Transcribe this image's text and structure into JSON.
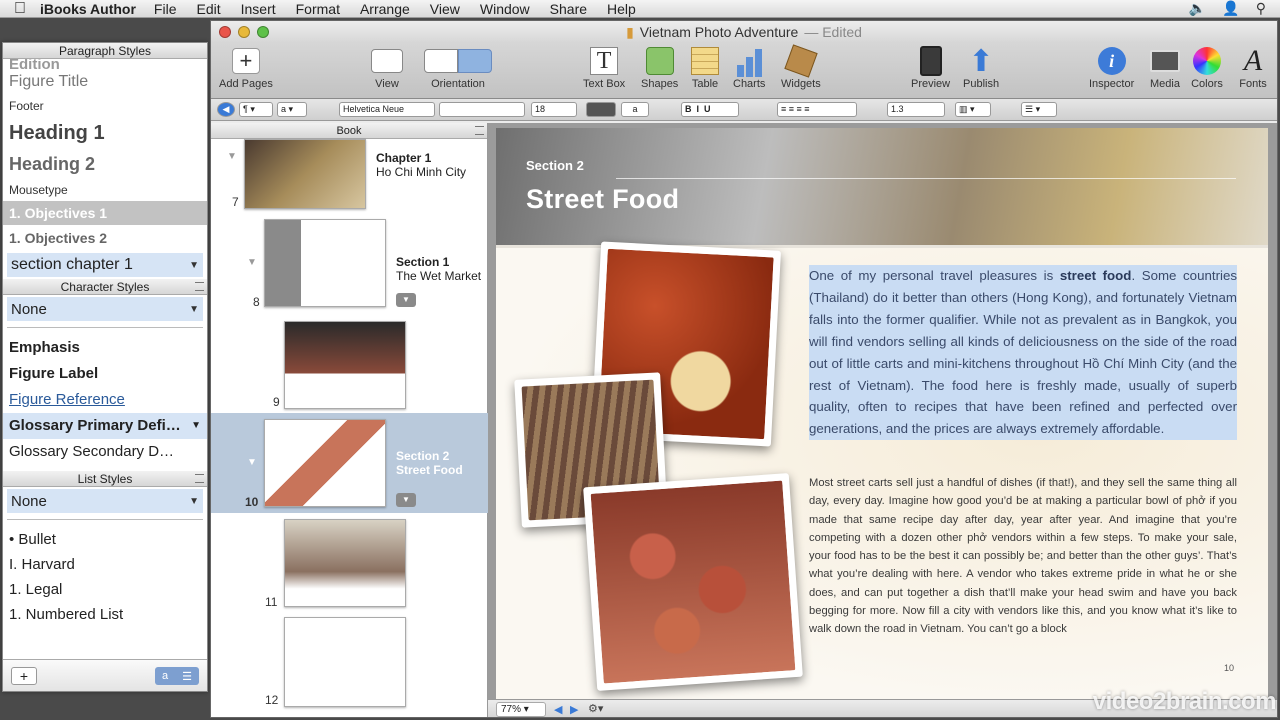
{
  "menubar": {
    "app_name": "iBooks Author",
    "items": [
      "File",
      "Edit",
      "Insert",
      "Format",
      "Arrange",
      "View",
      "Window",
      "Share",
      "Help"
    ]
  },
  "window": {
    "title": "Vietnam Photo Adventure",
    "edited": "— Edited"
  },
  "toolbar": {
    "add_pages": "Add Pages",
    "view": "View",
    "orientation": "Orientation",
    "text_box": "Text Box",
    "shapes": "Shapes",
    "table": "Table",
    "charts": "Charts",
    "widgets": "Widgets",
    "preview": "Preview",
    "publish": "Publish",
    "inspector": "Inspector",
    "media": "Media",
    "colors": "Colors",
    "fonts": "Fonts"
  },
  "formatbar": {
    "font_family": "Helvetica Neue",
    "font_size": "18",
    "line_spacing": "1.3"
  },
  "drawer": {
    "paragraph_header": "Paragraph Styles",
    "paragraph_items": [
      "Edition",
      "Figure Title",
      "Footer",
      "Heading 1",
      "Heading 2",
      "Mousetype",
      "1. Objectives 1",
      "1. Objectives 2"
    ],
    "paragraph_selected": "section chapter 1",
    "character_header": "Character Styles",
    "character_selected": "None",
    "character_items": [
      "Emphasis",
      "Figure Label",
      "Figure Reference",
      "Glossary Primary Defi…",
      "Glossary Secondary D…"
    ],
    "list_header": "List Styles",
    "list_selected": "None",
    "list_items": [
      "• Bullet",
      "I. Harvard",
      "1. Legal",
      "1. Numbered List"
    ]
  },
  "book": {
    "header": "Book",
    "rows": [
      {
        "num": "7",
        "title": "Chapter 1",
        "subtitle": "Ho Chi Minh City"
      },
      {
        "num": "8",
        "title": "Section 1",
        "subtitle": "The Wet Market"
      },
      {
        "num": "9"
      },
      {
        "num": "10",
        "title": "Section 2",
        "subtitle": "Street Food"
      },
      {
        "num": "11"
      },
      {
        "num": "12"
      }
    ]
  },
  "page": {
    "section_label": "Section 2",
    "title": "Street Food",
    "lead_1": "One of my personal travel pleasures is ",
    "lead_bold": "street food",
    "lead_2": ". Some countries (Thailand) do it better than others (Hong Kong), and fortunately Vietnam falls into the former qualifier. While not as prevalent as in Bangkok, you will find vendors selling all kinds of deliciousness on the side of the road out of little carts and mini-kitchens throughout Hồ Chí Minh City (and the rest of Vietnam). The food here is freshly made, usually of superb quality, often to recipes that have been refined and perfected over generations, and the prices are always extremely affordable.",
    "body": "Most street carts sell just a handful of dishes (if that!), and they sell the same thing all day, every day. Imagine how good you’d be at making a particular bowl of phở if you made that same recipe day after day, year after year. And imagine that you’re competing with a dozen other phở vendors within a few steps. To make your sale, your food has to be the best it can possibly be; and better than the other guys’. That’s what you’re dealing with here. A vendor who takes extreme pride in what he or she does, and can put together a dish that’ll make your head swim and have you back begging for more. Now fill a city with vendors like this, and you know what it’s like to walk down the road in Vietnam. You can’t go a block",
    "page_number": "10"
  },
  "status": {
    "zoom": "77%"
  },
  "watermark": "video2brain.com"
}
